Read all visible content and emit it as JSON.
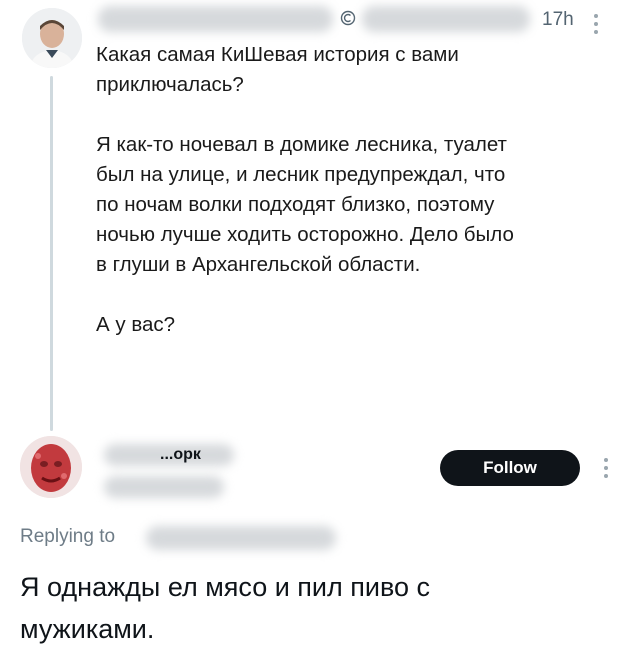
{
  "original_post": {
    "timestamp": "17h",
    "body": "Какая самая КиШевая история с вами\nприключалась?\n\nЯ как-то ночевал в домике лесника, туалет\nбыл на улице, и лесник предупреждал, что\nпо ночам волки подходят близко, поэтому\nночью лучше ходить осторожно. Дело было\nв глуши в Архангельской области.\n\nА у вас?"
  },
  "reply": {
    "username_fragment": "...opк",
    "follow_label": "Follow",
    "replying_to_label": "Replying to",
    "body": "Я однажды ел мясо и пил пиво с\nмужиками."
  },
  "colors": {
    "follow_bg": "#0f1419",
    "thread_line": "#cfd9de",
    "muted_text": "#536471",
    "censor_blur": "#d6d9dc"
  },
  "icons": [
    "avatar-man-photo",
    "avatar-red-face",
    "more-options-icon",
    "verified-badge-icon"
  ]
}
